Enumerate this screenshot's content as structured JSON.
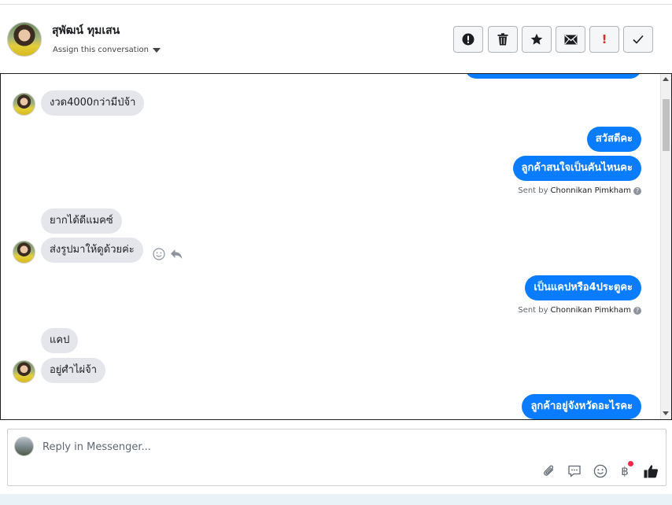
{
  "header": {
    "contact_name": "สุพัฒน์ ทุมเสน",
    "assign_label": "Assign this conversation",
    "tools": [
      "spam-icon",
      "trash-icon",
      "star-icon",
      "mail-icon",
      "important-icon",
      "done-icon"
    ],
    "important_glyph": "!"
  },
  "messages": [
    {
      "id": "m0",
      "dir": "out",
      "text": ""
    },
    {
      "id": "m1",
      "dir": "in",
      "text": "งวด4000กว่ามีป่จ้า"
    },
    {
      "id": "m2",
      "dir": "out",
      "text": "สวัสดีคะ"
    },
    {
      "id": "m3",
      "dir": "out",
      "text": "ลูกค้าสนใจเป็นคันไหนคะ"
    },
    {
      "id": "m4",
      "dir": "in",
      "text": "ยากได้ดีแมคซ์"
    },
    {
      "id": "m5",
      "dir": "in",
      "text": "ส่งรูปมาให้ดูด้วยค่ะ"
    },
    {
      "id": "m6",
      "dir": "out",
      "text": "เป็นแคปหรือ4ประตูคะ"
    },
    {
      "id": "m7",
      "dir": "in",
      "text": "แคป"
    },
    {
      "id": "m8",
      "dir": "in",
      "text": "อยู่ศำไผ่จ้า"
    },
    {
      "id": "m9",
      "dir": "out",
      "text": "ลูกค้าอยู่จังหวัดอะไรคะ"
    }
  ],
  "sent_by": {
    "prefix": "Sent by",
    "agent": "Chonnikan Pimkham",
    "help": "?"
  },
  "composer": {
    "placeholder": "Reply in Messenger...",
    "icons": [
      "attachment-icon",
      "saved-reply-icon",
      "emoji-icon",
      "payment-icon",
      "like-icon"
    ],
    "payment_glyph": "฿"
  },
  "colors": {
    "outgoing_bubble": "#0a7cff",
    "incoming_bubble": "#e4e6eb",
    "notification_dot": "#f02849",
    "important_icon": "#d93025"
  }
}
